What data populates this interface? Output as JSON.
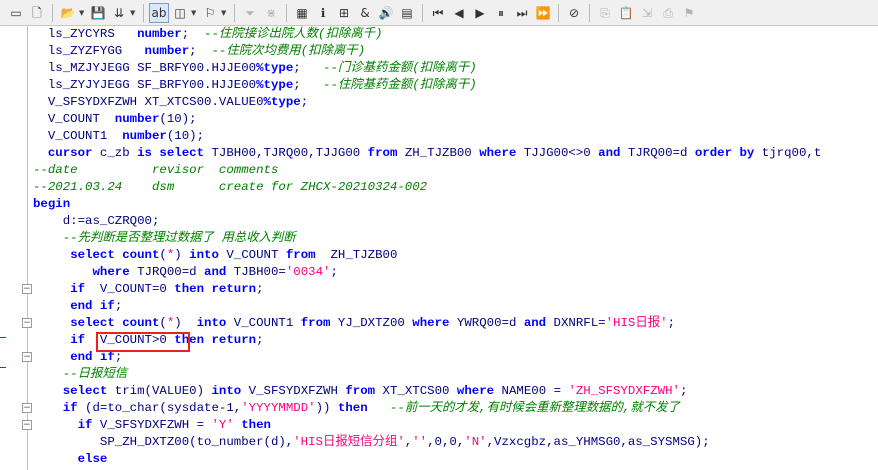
{
  "toolbar": {
    "buttons": [
      {
        "name": "new-file-icon",
        "glyph": "▭",
        "dropdown": false
      },
      {
        "name": "new-document-icon",
        "glyph": "🗋",
        "dropdown": false
      },
      {
        "name": "open-folder-icon",
        "glyph": "📂",
        "dropdown": true
      },
      {
        "name": "save-icon",
        "glyph": "💾",
        "dropdown": false
      },
      {
        "name": "save-all-icon",
        "glyph": "⇊",
        "dropdown": true
      },
      {
        "name": "text-mode-icon",
        "glyph": "ab",
        "dropdown": false,
        "pressed": true
      },
      {
        "name": "window-icon",
        "glyph": "◫",
        "dropdown": true
      },
      {
        "name": "filter-run-icon",
        "glyph": "⚐",
        "dropdown": true
      },
      {
        "name": "funnel-icon",
        "glyph": "⏷",
        "dropdown": false,
        "disabled": true
      },
      {
        "name": "clear-filter-icon",
        "glyph": "⋇",
        "dropdown": false,
        "disabled": true
      },
      {
        "name": "grid-icon",
        "glyph": "▦",
        "dropdown": false
      },
      {
        "name": "columns-icon",
        "glyph": "ℹ",
        "dropdown": false
      },
      {
        "name": "sequence-icon",
        "glyph": "⊞",
        "dropdown": false
      },
      {
        "name": "ampersand-icon",
        "glyph": "&",
        "dropdown": false
      },
      {
        "name": "speaker-icon",
        "glyph": "🔊",
        "dropdown": false
      },
      {
        "name": "document-view-icon",
        "glyph": "▤",
        "dropdown": false
      },
      {
        "name": "first-icon",
        "glyph": "⏮",
        "dropdown": false
      },
      {
        "name": "prev-icon",
        "glyph": "◀",
        "dropdown": false
      },
      {
        "name": "play-icon",
        "glyph": "▶",
        "dropdown": false
      },
      {
        "name": "pause-icon",
        "glyph": "⏸",
        "dropdown": false
      },
      {
        "name": "next-icon",
        "glyph": "⏭",
        "dropdown": false
      },
      {
        "name": "last-icon",
        "glyph": "⏩",
        "dropdown": false
      },
      {
        "name": "stop-debug-icon",
        "glyph": "⊘",
        "dropdown": false
      },
      {
        "name": "copy-disabled-icon",
        "glyph": "⎘",
        "dropdown": false,
        "disabled": true
      },
      {
        "name": "paste-disabled-icon",
        "glyph": "📋",
        "dropdown": false,
        "disabled": true
      },
      {
        "name": "export-disabled-icon",
        "glyph": "⇲",
        "dropdown": false,
        "disabled": true
      },
      {
        "name": "print-disabled-icon",
        "glyph": "⎙",
        "dropdown": false,
        "disabled": true
      },
      {
        "name": "flag-disabled-icon",
        "glyph": "⚑",
        "dropdown": false,
        "disabled": true
      }
    ]
  },
  "code_lines": [
    [
      {
        "t": "  ls_ZYCYRS   ",
        "c": "plain"
      },
      {
        "t": "number",
        "c": "kw"
      },
      {
        "t": ";  ",
        "c": "plain"
      },
      {
        "t": "--住院接诊出院人数(扣除离千)",
        "c": "cm"
      }
    ],
    [
      {
        "t": "  ls_ZYZFYGG   ",
        "c": "plain"
      },
      {
        "t": "number",
        "c": "kw"
      },
      {
        "t": ";  ",
        "c": "plain"
      },
      {
        "t": "--住院次均费用(扣除离干)",
        "c": "cm"
      }
    ],
    [
      {
        "t": "  ls_MZJYJEGG SF_BRFY00.HJJE00",
        "c": "plain"
      },
      {
        "t": "%type",
        "c": "kw"
      },
      {
        "t": ";   ",
        "c": "plain"
      },
      {
        "t": "--门诊基药金额(扣除离干)",
        "c": "cm"
      }
    ],
    [
      {
        "t": "  ls_ZYJYJEGG SF_BRFY00.HJJE00",
        "c": "plain"
      },
      {
        "t": "%type",
        "c": "kw"
      },
      {
        "t": ";   ",
        "c": "plain"
      },
      {
        "t": "--住院基药金额(扣除离干)",
        "c": "cm"
      }
    ],
    [
      {
        "t": "  V_SFSYDXFZWH XT_XTCS00.VALUE0",
        "c": "plain"
      },
      {
        "t": "%type",
        "c": "kw"
      },
      {
        "t": ";",
        "c": "plain"
      }
    ],
    [
      {
        "t": "  V_COUNT  ",
        "c": "plain"
      },
      {
        "t": "number",
        "c": "kw"
      },
      {
        "t": "(10);",
        "c": "plain"
      }
    ],
    [
      {
        "t": "  V_COUNT1  ",
        "c": "plain"
      },
      {
        "t": "number",
        "c": "kw"
      },
      {
        "t": "(10);",
        "c": "plain"
      }
    ],
    [
      {
        "t": "  ",
        "c": "plain"
      },
      {
        "t": "cursor",
        "c": "kw"
      },
      {
        "t": " c_zb ",
        "c": "plain"
      },
      {
        "t": "is select",
        "c": "kw"
      },
      {
        "t": " TJBH00,TJRQ00,TJJG00 ",
        "c": "plain"
      },
      {
        "t": "from",
        "c": "kw"
      },
      {
        "t": " ZH_TJZB00 ",
        "c": "plain"
      },
      {
        "t": "where",
        "c": "kw"
      },
      {
        "t": " TJJG00<>0 ",
        "c": "plain"
      },
      {
        "t": "and",
        "c": "kw"
      },
      {
        "t": " TJRQ00=d ",
        "c": "plain"
      },
      {
        "t": "order by",
        "c": "kw"
      },
      {
        "t": " tjrq00,t",
        "c": "plain"
      }
    ],
    [
      {
        "t": "--date          revisor  comments",
        "c": "cm"
      }
    ],
    [
      {
        "t": "--2021.03.24    dsm      create for ZHCX-20210324-002",
        "c": "cm"
      }
    ],
    [
      {
        "t": "begin",
        "c": "kw"
      }
    ],
    [
      {
        "t": "    d:=as_CZRQ00;",
        "c": "plain"
      }
    ],
    [
      {
        "t": "    ",
        "c": "plain"
      },
      {
        "t": "--先判断是否整理过数据了 用总收入判断",
        "c": "cm"
      }
    ],
    [
      {
        "t": "     ",
        "c": "plain"
      },
      {
        "t": "select count",
        "c": "kw"
      },
      {
        "t": "(",
        "c": "plain"
      },
      {
        "t": "*",
        "c": "str"
      },
      {
        "t": ") ",
        "c": "plain"
      },
      {
        "t": "into",
        "c": "kw"
      },
      {
        "t": " V_COUNT ",
        "c": "plain"
      },
      {
        "t": "from",
        "c": "kw"
      },
      {
        "t": "  ZH_TJZB00",
        "c": "plain"
      }
    ],
    [
      {
        "t": "        ",
        "c": "plain"
      },
      {
        "t": "where",
        "c": "kw"
      },
      {
        "t": " TJRQ00=d ",
        "c": "plain"
      },
      {
        "t": "and",
        "c": "kw"
      },
      {
        "t": " TJBH00=",
        "c": "plain"
      },
      {
        "t": "'0034'",
        "c": "str"
      },
      {
        "t": ";",
        "c": "plain"
      }
    ],
    [
      {
        "t": "     ",
        "c": "plain"
      },
      {
        "t": "if",
        "c": "kw"
      },
      {
        "t": "  V_COUNT=0 ",
        "c": "plain"
      },
      {
        "t": "then return",
        "c": "kw"
      },
      {
        "t": ";",
        "c": "plain"
      }
    ],
    [
      {
        "t": "     ",
        "c": "plain"
      },
      {
        "t": "end if",
        "c": "kw"
      },
      {
        "t": ";",
        "c": "plain"
      }
    ],
    [
      {
        "t": "     ",
        "c": "plain"
      },
      {
        "t": "select count",
        "c": "kw"
      },
      {
        "t": "(",
        "c": "plain"
      },
      {
        "t": "*",
        "c": "str"
      },
      {
        "t": ")  ",
        "c": "plain"
      },
      {
        "t": "into",
        "c": "kw"
      },
      {
        "t": " V_COUNT1 ",
        "c": "plain"
      },
      {
        "t": "from",
        "c": "kw"
      },
      {
        "t": " YJ_DXTZ00 ",
        "c": "plain"
      },
      {
        "t": "where",
        "c": "kw"
      },
      {
        "t": " YWRQ00=d ",
        "c": "plain"
      },
      {
        "t": "and",
        "c": "kw"
      },
      {
        "t": " DXNRFL=",
        "c": "plain"
      },
      {
        "t": "'HIS日报'",
        "c": "str"
      },
      {
        "t": ";",
        "c": "plain"
      }
    ],
    [
      {
        "t": "     ",
        "c": "plain"
      },
      {
        "t": "if",
        "c": "kw"
      },
      {
        "t": "  V_COUNT>0 ",
        "c": "plain"
      },
      {
        "t": "then return",
        "c": "kw"
      },
      {
        "t": ";",
        "c": "plain"
      }
    ],
    [
      {
        "t": "     ",
        "c": "plain"
      },
      {
        "t": "end if",
        "c": "kw"
      },
      {
        "t": ";",
        "c": "plain"
      }
    ],
    [
      {
        "t": "    ",
        "c": "plain"
      },
      {
        "t": "--日报短信",
        "c": "cm"
      }
    ],
    [
      {
        "t": "    ",
        "c": "plain"
      },
      {
        "t": "select",
        "c": "kw"
      },
      {
        "t": " trim(VALUE0) ",
        "c": "plain"
      },
      {
        "t": "into",
        "c": "kw"
      },
      {
        "t": " V_SFSYDXFZWH ",
        "c": "plain"
      },
      {
        "t": "from",
        "c": "kw"
      },
      {
        "t": " XT_XTCS00 ",
        "c": "plain"
      },
      {
        "t": "where",
        "c": "kw"
      },
      {
        "t": " NAME00 = ",
        "c": "plain"
      },
      {
        "t": "'ZH_SFSYDXFZWH'",
        "c": "str"
      },
      {
        "t": ";",
        "c": "plain"
      }
    ],
    [
      {
        "t": "    ",
        "c": "plain"
      },
      {
        "t": "if",
        "c": "kw"
      },
      {
        "t": " (d=to_char(sysdate-1,",
        "c": "plain"
      },
      {
        "t": "'YYYYMMDD'",
        "c": "str"
      },
      {
        "t": ")) ",
        "c": "plain"
      },
      {
        "t": "then",
        "c": "kw"
      },
      {
        "t": "   ",
        "c": "plain"
      },
      {
        "t": "--前一天的才发,有时候会重新整理数据的,就不发了",
        "c": "cm"
      }
    ],
    [
      {
        "t": "      ",
        "c": "plain"
      },
      {
        "t": "if",
        "c": "kw"
      },
      {
        "t": " V_SFSYDXFZWH = ",
        "c": "plain"
      },
      {
        "t": "'Y'",
        "c": "str"
      },
      {
        "t": " ",
        "c": "plain"
      },
      {
        "t": "then",
        "c": "kw"
      }
    ],
    [
      {
        "t": "         SP_ZH_DXTZ00(to_number(d),",
        "c": "plain"
      },
      {
        "t": "'HIS日报短信分组'",
        "c": "str"
      },
      {
        "t": ",",
        "c": "plain"
      },
      {
        "t": "''",
        "c": "str"
      },
      {
        "t": ",0,0,",
        "c": "plain"
      },
      {
        "t": "'N'",
        "c": "str"
      },
      {
        "t": ",Vzxcgbz,as_YHMSG0,as_SYSMSG);",
        "c": "plain"
      }
    ],
    [
      {
        "t": "      ",
        "c": "plain"
      },
      {
        "t": "else",
        "c": "kw"
      }
    ]
  ],
  "fold_markers": [
    {
      "line": 15,
      "glyph": "−"
    },
    {
      "line": 17,
      "glyph": "−"
    },
    {
      "line": 19,
      "glyph": "−"
    },
    {
      "line": 22,
      "glyph": "−"
    },
    {
      "line": 23,
      "glyph": "−"
    }
  ]
}
